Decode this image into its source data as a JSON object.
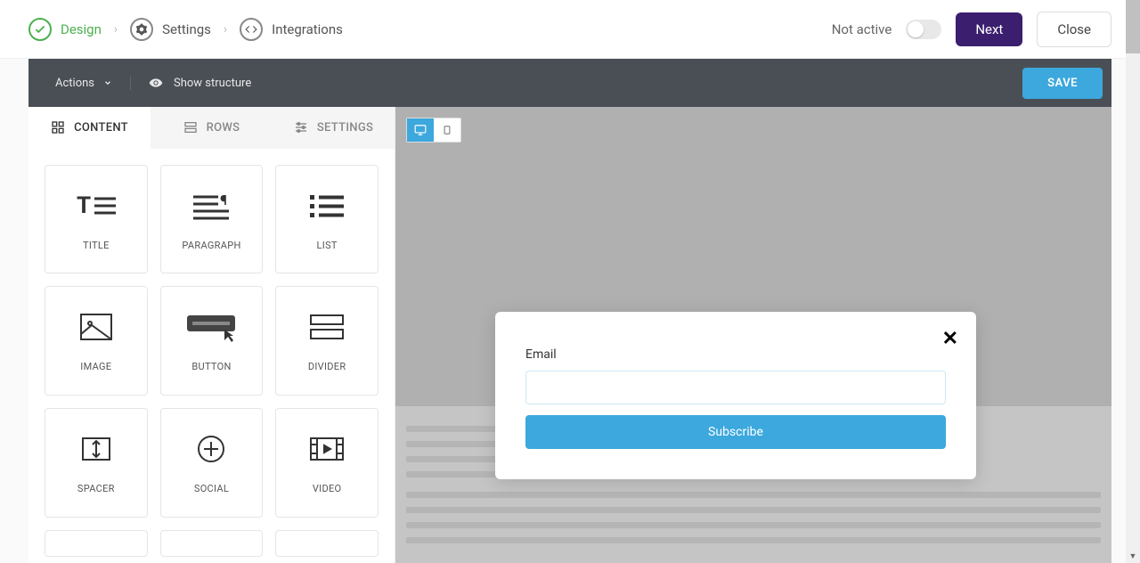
{
  "breadcrumbs": {
    "design": "Design",
    "settings": "Settings",
    "integrations": "Integrations"
  },
  "top_right": {
    "status": "Not active",
    "next": "Next",
    "close": "Close"
  },
  "action_bar": {
    "actions": "Actions",
    "show_structure": "Show structure",
    "save": "SAVE"
  },
  "panel_tabs": {
    "content": "CONTENT",
    "rows": "ROWS",
    "settings": "SETTINGS"
  },
  "blocks": {
    "title": "TITLE",
    "paragraph": "PARAGRAPH",
    "list": "LIST",
    "image": "IMAGE",
    "button": "BUTTON",
    "divider": "DIVIDER",
    "spacer": "SPACER",
    "social": "SOCIAL",
    "video": "VIDEO"
  },
  "popup": {
    "email_label": "Email",
    "submit": "Subscribe"
  },
  "icons": {
    "check": "check-icon",
    "gear": "gear-icon",
    "code": "code-icon",
    "chevron_right": "chevron-right-icon",
    "chevron_down": "chevron-down-icon",
    "eye": "eye-icon",
    "grid": "grid-icon",
    "rows": "rows-icon",
    "settings_lines": "settings-lines-icon",
    "desktop": "desktop-icon",
    "mobile": "mobile-icon",
    "close": "close-icon"
  }
}
